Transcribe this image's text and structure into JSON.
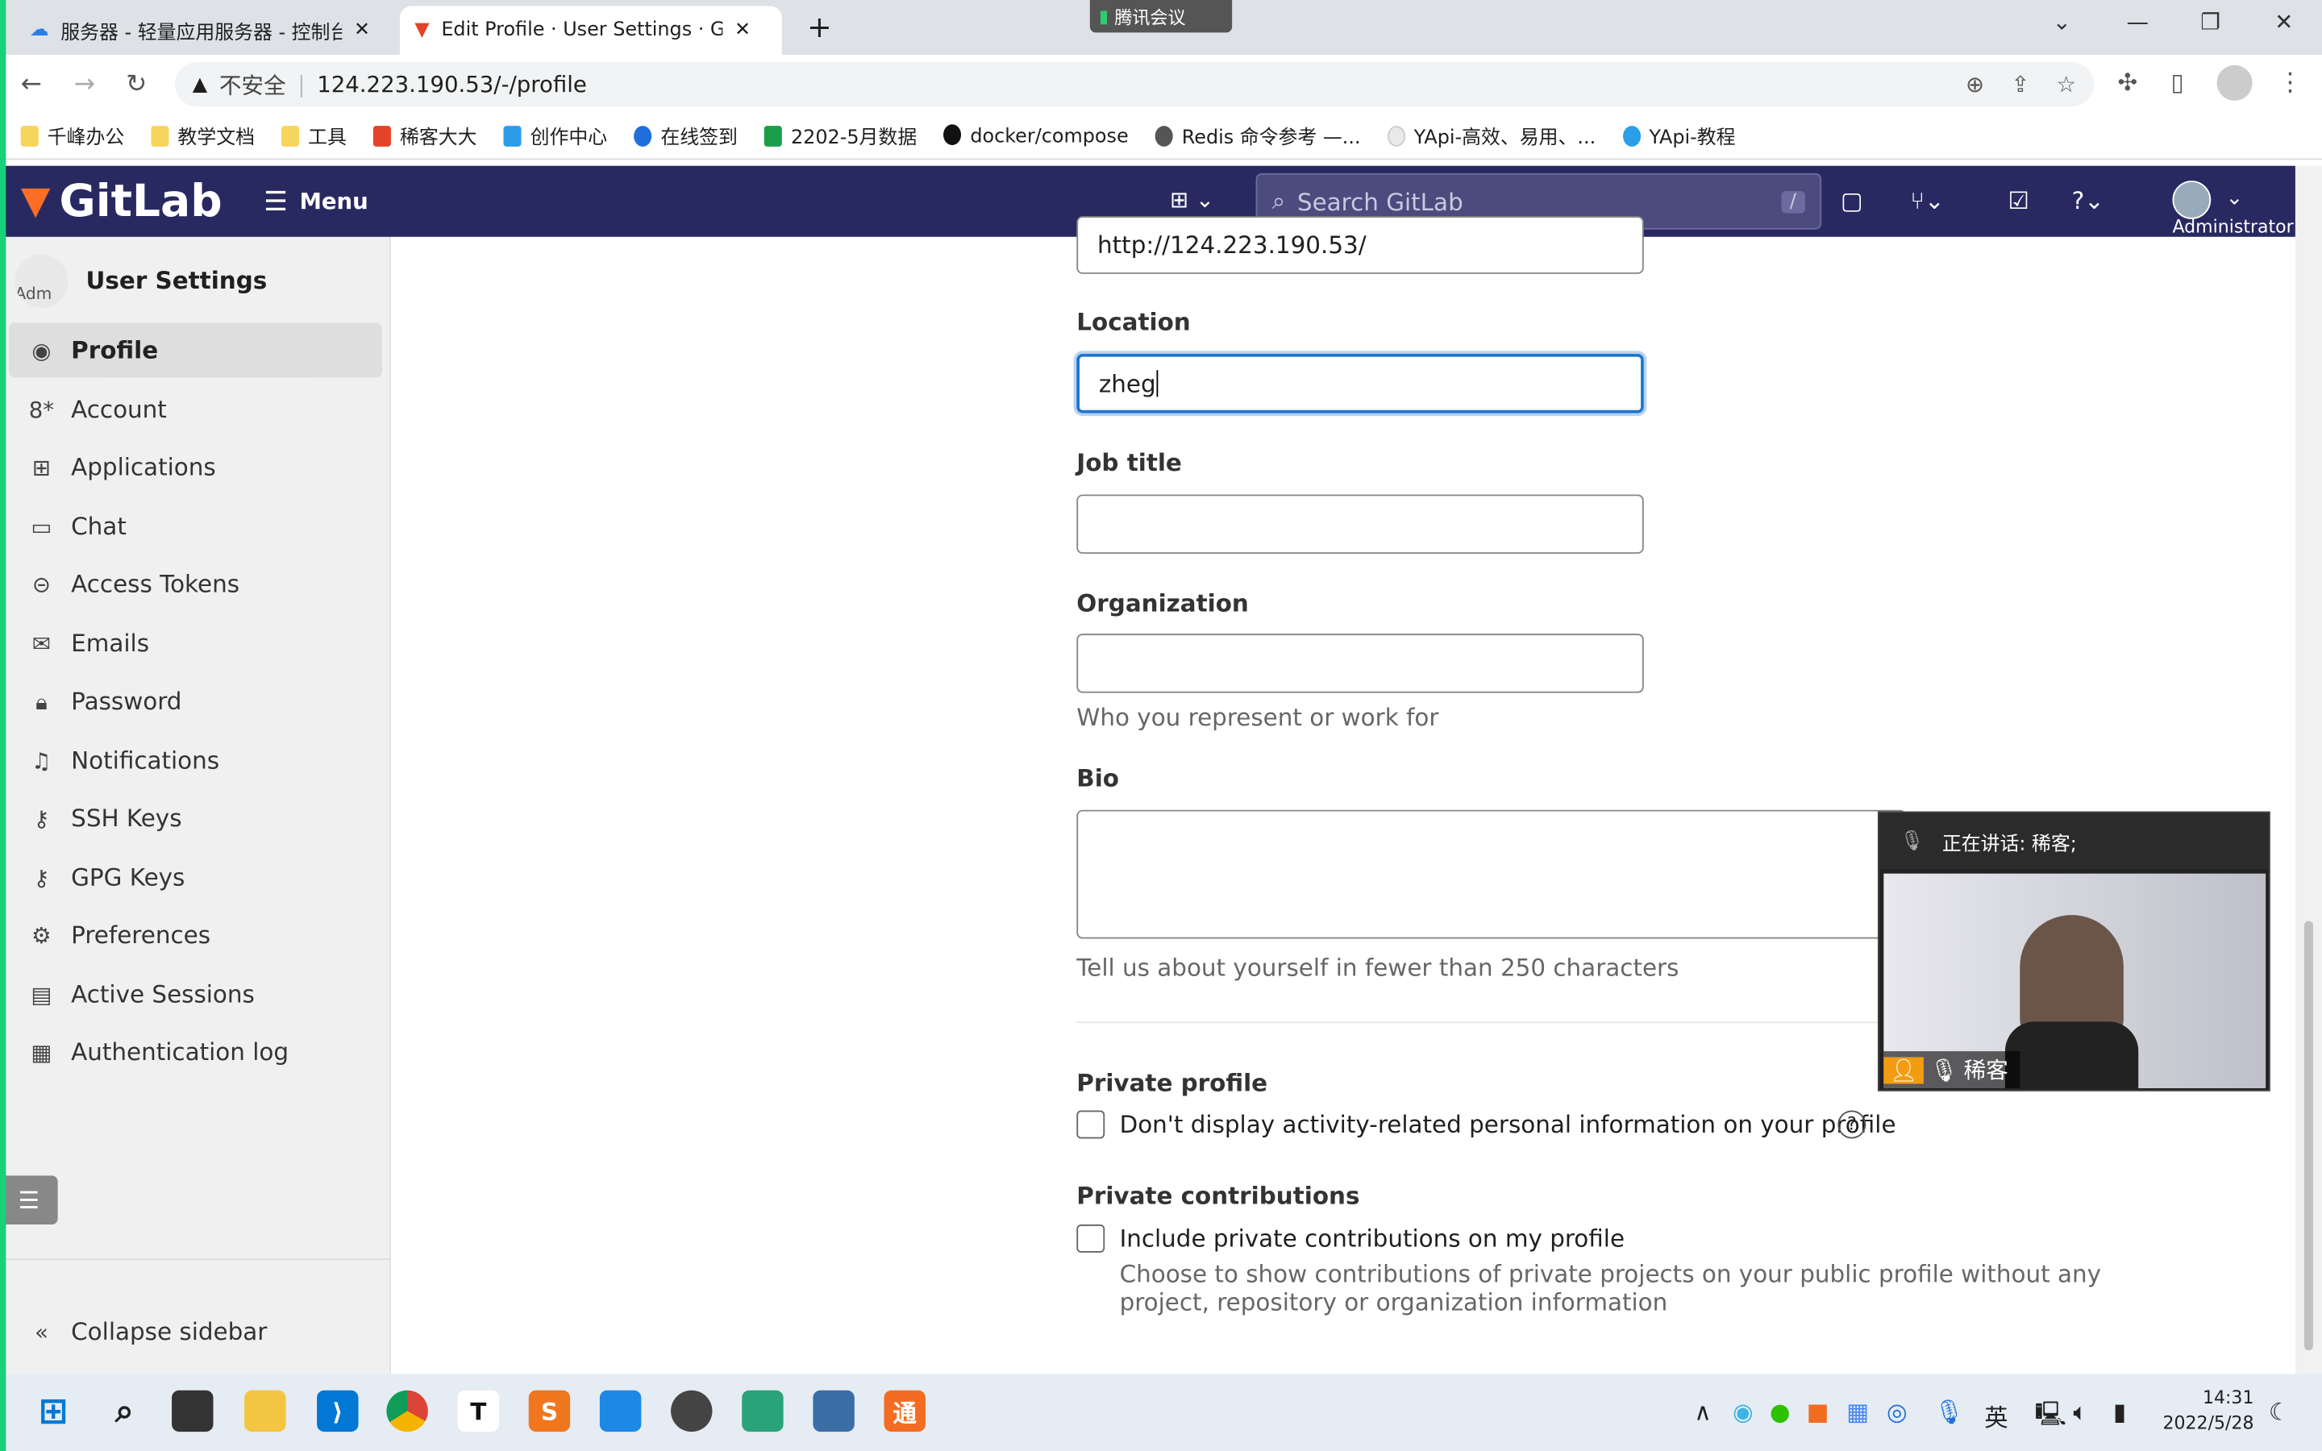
{
  "browser": {
    "tabs": [
      {
        "title": "服务器 - 轻量应用服务器 - 控制台",
        "active": false
      },
      {
        "title": "Edit Profile · User Settings · GitLab",
        "active": true
      }
    ],
    "new_tab": "+",
    "meeting_badge": "腾讯会议",
    "security": "不安全",
    "url": "124.223.190.53/-/profile",
    "bookmarks": [
      "千峰办公",
      "教学文档",
      "工具",
      "稀客大大",
      "创作中心",
      "在线签到",
      "2202-5月数据",
      "docker/compose",
      "Redis 命令参考 —...",
      "YApi-高效、易用、...",
      "YApi-教程"
    ]
  },
  "gitlab": {
    "brand": "GitLab",
    "menu": "Menu",
    "search_placeholder": "Search GitLab",
    "search_shortcut": "/",
    "user": "Administrator",
    "header_color": "#292961"
  },
  "sidebar": {
    "title": "User Settings",
    "avatar_alt": "Adm",
    "items": [
      {
        "label": "Profile",
        "icon": "user-icon",
        "active": true
      },
      {
        "label": "Account",
        "icon": "account-icon"
      },
      {
        "label": "Applications",
        "icon": "applications-icon"
      },
      {
        "label": "Chat",
        "icon": "chat-icon"
      },
      {
        "label": "Access Tokens",
        "icon": "token-icon"
      },
      {
        "label": "Emails",
        "icon": "mail-icon"
      },
      {
        "label": "Password",
        "icon": "lock-icon"
      },
      {
        "label": "Notifications",
        "icon": "bell-icon"
      },
      {
        "label": "SSH Keys",
        "icon": "key-icon"
      },
      {
        "label": "GPG Keys",
        "icon": "key-icon"
      },
      {
        "label": "Preferences",
        "icon": "preferences-icon"
      },
      {
        "label": "Active Sessions",
        "icon": "monitor-icon"
      },
      {
        "label": "Authentication log",
        "icon": "log-icon"
      }
    ],
    "collapse": "Collapse sidebar"
  },
  "form": {
    "website_value": "http://124.223.190.53/",
    "location_label": "Location",
    "location_value": "zheg",
    "job_label": "Job title",
    "job_value": "",
    "org_label": "Organization",
    "org_value": "",
    "org_help": "Who you represent or work for",
    "bio_label": "Bio",
    "bio_value": "",
    "bio_help": "Tell us about yourself in fewer than 250 characters",
    "private_profile_label": "Private profile",
    "private_profile_check": "Don't display activity-related personal information on your profile",
    "private_contrib_label": "Private contributions",
    "private_contrib_check": "Include private contributions on my profile",
    "private_contrib_help": "Choose to show contributions of private projects on your public profile without any project, repository or organization information"
  },
  "meeting": {
    "speaking": "正在讲话: 稀客;",
    "name": "稀客"
  },
  "taskbar": {
    "ime": "英",
    "time": "14:31",
    "date": "2022/5/28"
  }
}
